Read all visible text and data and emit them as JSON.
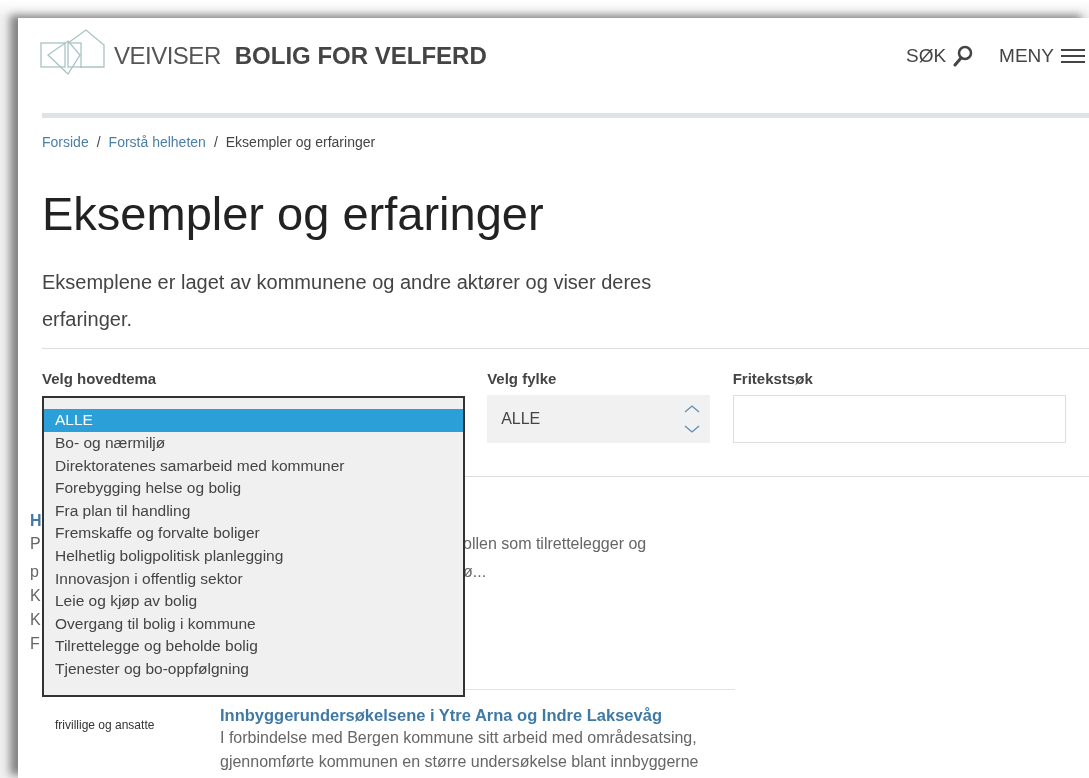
{
  "header": {
    "logo_light": "VEIVISER",
    "logo_bold": "BOLIG FOR VELFERD",
    "search": "SØK",
    "menu": "MENY"
  },
  "breadcrumb": [
    {
      "label": "Forside",
      "link": true
    },
    {
      "label": "Forstå helheten",
      "link": true
    },
    {
      "label": "Eksempler og erfaringer",
      "link": false
    }
  ],
  "separator": "/",
  "title": "Eksempler og erfaringer",
  "intro": "Eksemplene er laget av kommunene og andre aktører og viser deres erfaringer.",
  "filters": [
    {
      "kind": "listbox",
      "label": "Velg hovedtema",
      "expanded": true,
      "options": [
        {
          "label": "ALLE",
          "selected": true
        },
        {
          "label": "Bo- og nærmiljø",
          "selected": false
        },
        {
          "label": "Direktoratenes samarbeid med kommuner",
          "selected": false
        },
        {
          "label": "Forebygging helse og bolig",
          "selected": false
        },
        {
          "label": "Fra plan til handling",
          "selected": false
        },
        {
          "label": "Fremskaffe og forvalte boliger",
          "selected": false
        },
        {
          "label": "Helhetlig boligpolitisk planlegging",
          "selected": false
        },
        {
          "label": "Innovasjon i offentlig sektor",
          "selected": false
        },
        {
          "label": "Leie og kjøp av bolig",
          "selected": false
        },
        {
          "label": "Overgang til bolig i kommune",
          "selected": false
        },
        {
          "label": "Tilrettelegge og beholde bolig",
          "selected": false
        },
        {
          "label": "Tjenester og bo-oppfølgning",
          "selected": false
        }
      ]
    },
    {
      "kind": "select",
      "label": "Velg fylke",
      "value": "ALLE"
    },
    {
      "kind": "text",
      "label": "Fritekstsøk"
    }
  ],
  "results": [
    {
      "title": "H",
      "lines": [
        {
          "left": "P",
          "right": "ollen som tilrettelegger og"
        },
        {
          "left": "p",
          "right": "ø..."
        },
        {
          "left": "K"
        },
        {
          "left": "K"
        },
        {
          "left": "F"
        }
      ]
    },
    {
      "caption": "frivillige og ansatte",
      "title": "Innbyggerundersøkelsene i Ytre Arna og Indre Laksevåg",
      "lines": [
        {
          "right": "I forbindelse med Bergen kommune sitt arbeid med områdesatsing,"
        },
        {
          "right": "gjennomførte kommunen en større undersøkelse blant innbyggerne"
        }
      ]
    }
  ]
}
